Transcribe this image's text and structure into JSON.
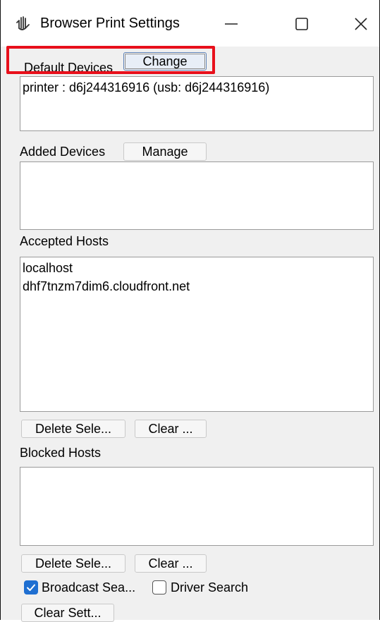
{
  "window": {
    "title": "Browser Print Settings"
  },
  "default_devices": {
    "label": "Default Devices",
    "change_button": "Change",
    "items": [
      "printer : d6j244316916 (usb: d6j244316916)"
    ]
  },
  "added_devices": {
    "label": "Added Devices",
    "manage_button": "Manage",
    "items": []
  },
  "accepted_hosts": {
    "label": "Accepted Hosts",
    "items": [
      "localhost",
      "dhf7tnzm7dim6.cloudfront.net"
    ],
    "delete_button": "Delete Sele...",
    "clear_button": "Clear ..."
  },
  "blocked_hosts": {
    "label": "Blocked Hosts",
    "items": [],
    "delete_button": "Delete Sele...",
    "clear_button": "Clear ..."
  },
  "options": {
    "broadcast_search": {
      "label": "Broadcast Sea...",
      "checked": true
    },
    "driver_search": {
      "label": "Driver Search",
      "checked": false
    }
  },
  "clear_settings_button": "Clear Sett...",
  "colors": {
    "highlight": "#e8101b",
    "checkbox_accent": "#1f6fd1"
  }
}
